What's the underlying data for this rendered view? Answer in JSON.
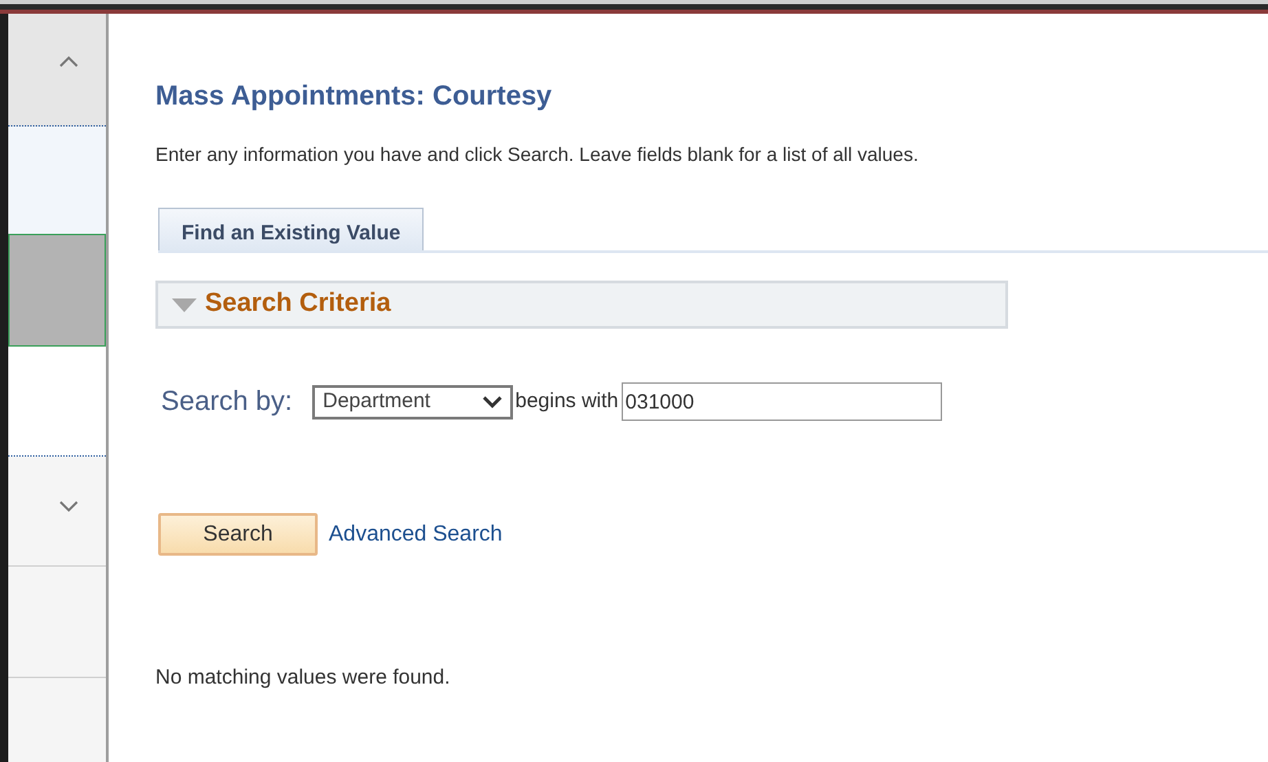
{
  "sidebar": {
    "items": [
      {
        "selected": false
      },
      {
        "selected": true
      },
      {
        "selected": false
      }
    ]
  },
  "page": {
    "title": "Mass Appointments: Courtesy",
    "instructions": "Enter any information you have and click Search. Leave fields blank for a list of all values."
  },
  "tabs": [
    {
      "label": "Find an Existing Value",
      "selected": true
    }
  ],
  "search_criteria": {
    "title": "Search Criteria",
    "expanded": true,
    "search_by_label": "Search by:",
    "field": "Department",
    "operator": "begins with",
    "value": "031000"
  },
  "buttons": {
    "search": "Search",
    "advanced": "Advanced Search"
  },
  "message": "No matching values were found."
}
